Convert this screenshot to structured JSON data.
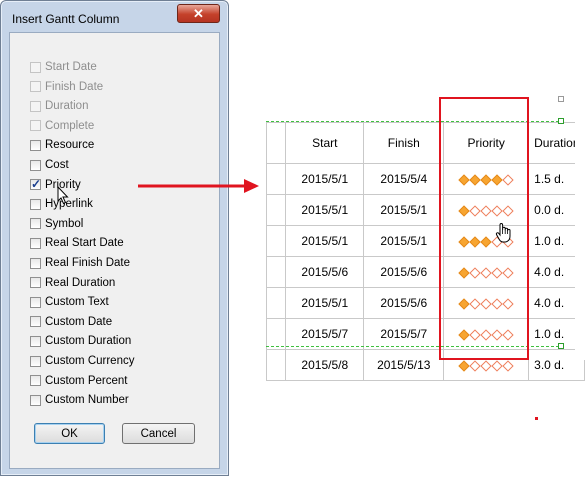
{
  "dialog": {
    "title": "Insert Gantt Column",
    "close_glyph": "✕",
    "options": [
      {
        "label": "Start Date",
        "checked": false,
        "disabled": true
      },
      {
        "label": "Finish Date",
        "checked": false,
        "disabled": true
      },
      {
        "label": "Duration",
        "checked": false,
        "disabled": true
      },
      {
        "label": "Complete",
        "checked": false,
        "disabled": true
      },
      {
        "label": "Resource",
        "checked": false,
        "disabled": false
      },
      {
        "label": "Cost",
        "checked": false,
        "disabled": false
      },
      {
        "label": "Priority",
        "checked": true,
        "disabled": false
      },
      {
        "label": "Hyperlink",
        "checked": false,
        "disabled": false
      },
      {
        "label": "Symbol",
        "checked": false,
        "disabled": false
      },
      {
        "label": "Real Start Date",
        "checked": false,
        "disabled": false
      },
      {
        "label": "Real Finish Date",
        "checked": false,
        "disabled": false
      },
      {
        "label": "Real Duration",
        "checked": false,
        "disabled": false
      },
      {
        "label": "Custom Text",
        "checked": false,
        "disabled": false
      },
      {
        "label": "Custom Date",
        "checked": false,
        "disabled": false
      },
      {
        "label": "Custom Duration",
        "checked": false,
        "disabled": false
      },
      {
        "label": "Custom Currency",
        "checked": false,
        "disabled": false
      },
      {
        "label": "Custom Percent",
        "checked": false,
        "disabled": false
      },
      {
        "label": "Custom Number",
        "checked": false,
        "disabled": false
      }
    ],
    "ok_label": "OK",
    "cancel_label": "Cancel"
  },
  "gantt": {
    "headers": {
      "start": "Start",
      "finish": "Finish",
      "priority": "Priority",
      "duration": "Duration"
    },
    "rows": [
      {
        "start": "2015/5/1",
        "finish": "2015/5/4",
        "priority": 4,
        "duration": "1.5 d."
      },
      {
        "start": "2015/5/1",
        "finish": "2015/5/1",
        "priority": 1,
        "duration": "0.0 d."
      },
      {
        "start": "2015/5/1",
        "finish": "2015/5/1",
        "priority": 3,
        "duration": "1.0 d."
      },
      {
        "start": "2015/5/6",
        "finish": "2015/5/6",
        "priority": 1,
        "duration": "4.0 d."
      },
      {
        "start": "2015/5/1",
        "finish": "2015/5/6",
        "priority": 1,
        "duration": "4.0 d."
      },
      {
        "start": "2015/5/7",
        "finish": "2015/5/7",
        "priority": 1,
        "duration": "1.0 d."
      },
      {
        "start": "2015/5/8",
        "finish": "2015/5/13",
        "priority": 1,
        "duration": "3.0 d."
      }
    ],
    "priority_max": 5
  },
  "colors": {
    "highlight": "#e0141f",
    "diamond_on": "#f7a531",
    "diamond_off_border": "#ee7e5a",
    "selection_dash": "#3fbf3f"
  }
}
